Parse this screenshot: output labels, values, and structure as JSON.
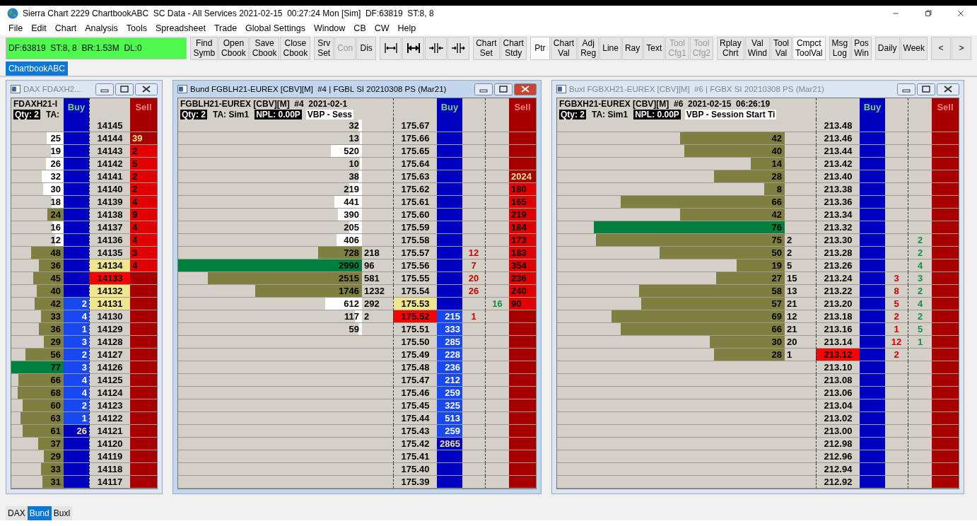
{
  "window": {
    "title": "Sierra Chart 2229 ChartbookABC  SC Data - All Services 2021-02-15  00:27:24 Mon [Sim]  DF:63819  ST:8, 8"
  },
  "menu": [
    "File",
    "Edit",
    "Chart",
    "Analysis",
    "Tools",
    "Spreadsheet",
    "Trade",
    "Global Settings",
    "Window",
    "CB",
    "CW",
    "Help"
  ],
  "status": "DF:63819  ST:8, 8  BR:1.53M  DL:0",
  "toolbar": {
    "groups": [
      [
        {
          "kind": "label",
          "lines": [
            "Find",
            "Symb"
          ],
          "selected": false,
          "disabled": false
        },
        {
          "kind": "label",
          "lines": [
            "Open",
            "Cbook"
          ],
          "selected": false,
          "disabled": false
        },
        {
          "kind": "label",
          "lines": [
            "Save",
            "Cbook"
          ],
          "selected": false,
          "disabled": false
        },
        {
          "kind": "label",
          "lines": [
            "Close",
            "Cbook"
          ],
          "selected": false,
          "disabled": false
        }
      ],
      [
        {
          "kind": "label",
          "lines": [
            "Srv",
            "Set"
          ],
          "selected": false,
          "disabled": false
        },
        {
          "kind": "label",
          "lines": [
            "Con"
          ],
          "selected": false,
          "disabled": true
        },
        {
          "kind": "label",
          "lines": [
            "Dis"
          ],
          "selected": false,
          "disabled": false
        }
      ],
      [
        {
          "kind": "icon",
          "selected": false,
          "disabled": false
        },
        {
          "kind": "icon",
          "selected": false,
          "disabled": false
        },
        {
          "kind": "icon",
          "selected": false,
          "disabled": false
        },
        {
          "kind": "icon",
          "selected": false,
          "disabled": false
        }
      ],
      [
        {
          "kind": "label",
          "lines": [
            "Chart",
            "Set"
          ],
          "selected": false,
          "disabled": false
        },
        {
          "kind": "label",
          "lines": [
            "Chart",
            "Stdy"
          ],
          "selected": false,
          "disabled": false
        }
      ],
      [
        {
          "kind": "label",
          "lines": [
            "Ptr"
          ],
          "selected": true,
          "disabled": false
        },
        {
          "kind": "label",
          "lines": [
            "Chart",
            "Val"
          ],
          "selected": false,
          "disabled": false
        },
        {
          "kind": "label",
          "lines": [
            "Adj",
            "Reg"
          ],
          "selected": false,
          "disabled": false
        },
        {
          "kind": "label",
          "lines": [
            "Line"
          ],
          "selected": false,
          "disabled": false
        },
        {
          "kind": "label",
          "lines": [
            "Ray"
          ],
          "selected": false,
          "disabled": false
        },
        {
          "kind": "label",
          "lines": [
            "Text"
          ],
          "selected": false,
          "disabled": false
        },
        {
          "kind": "label",
          "lines": [
            "Tool",
            "Cfg1"
          ],
          "selected": false,
          "disabled": true
        },
        {
          "kind": "label",
          "lines": [
            "Tool",
            "Cfg2"
          ],
          "selected": false,
          "disabled": true
        }
      ],
      [
        {
          "kind": "label",
          "lines": [
            "Rplay",
            "Chrt"
          ],
          "selected": false,
          "disabled": false
        },
        {
          "kind": "label",
          "lines": [
            "Val",
            "Wind"
          ],
          "selected": false,
          "disabled": false
        },
        {
          "kind": "label",
          "lines": [
            "Tool",
            "Val"
          ],
          "selected": false,
          "disabled": false
        },
        {
          "kind": "label",
          "lines": [
            "Cmpct",
            "ToolVal"
          ],
          "selected": true,
          "disabled": false
        }
      ],
      [
        {
          "kind": "label",
          "lines": [
            "Msg",
            "Log"
          ],
          "selected": false,
          "disabled": false
        },
        {
          "kind": "label",
          "lines": [
            "Pos",
            "Win"
          ],
          "selected": false,
          "disabled": false
        }
      ],
      [
        {
          "kind": "label",
          "lines": [
            "Daily"
          ],
          "selected": false,
          "disabled": false
        },
        {
          "kind": "label",
          "lines": [
            "Week"
          ],
          "selected": false,
          "disabled": false
        }
      ]
    ],
    "scroll": [
      "<",
      ">"
    ]
  },
  "chartbook_tabs": [
    {
      "label": "ChartbookABC",
      "selected": true
    }
  ],
  "windows": [
    {
      "title": "DAX FDAXH2...",
      "active": false,
      "kind": "compact",
      "symbol": "FDAXH21-I",
      "info": [
        {
          "text": "Qty: 2",
          "kind": "inverse"
        },
        {
          "text": "TA:",
          "kind": "plain"
        }
      ],
      "buy_header": "Buy",
      "sell_header": "Sell",
      "rows": [
        {
          "price": "14145",
          "kind": "none"
        },
        {
          "price": "14144",
          "volume": "25",
          "level": 0.32,
          "value_area": false,
          "poc": false,
          "kind": "none",
          "ask": {
            "text": "39",
            "total": true
          }
        },
        {
          "price": "14143",
          "volume": "19",
          "level": 0.25,
          "value_area": false,
          "poc": false,
          "kind": "none",
          "ask": {
            "text": "2",
            "total": false
          }
        },
        {
          "price": "14142",
          "volume": "26",
          "level": 0.34,
          "value_area": false,
          "poc": false,
          "kind": "none",
          "ask": {
            "text": "5",
            "total": false
          }
        },
        {
          "price": "14141",
          "volume": "32",
          "level": 0.42,
          "value_area": false,
          "poc": false,
          "kind": "none",
          "ask": {
            "text": "2",
            "total": false
          }
        },
        {
          "price": "14140",
          "volume": "30",
          "level": 0.39,
          "value_area": false,
          "poc": false,
          "kind": "none",
          "ask": {
            "text": "2",
            "total": false
          }
        },
        {
          "price": "14139",
          "volume": "18",
          "level": 0.23,
          "value_area": false,
          "poc": false,
          "kind": "none",
          "ask": {
            "text": "4",
            "total": false
          }
        },
        {
          "price": "14138",
          "volume": "24",
          "level": 0.31,
          "value_area": true,
          "poc": false,
          "kind": "none",
          "ask": {
            "text": "9",
            "total": false
          }
        },
        {
          "price": "14137",
          "volume": "16",
          "level": 0.21,
          "value_area": false,
          "poc": false,
          "kind": "none",
          "ask": {
            "text": "4",
            "total": false
          }
        },
        {
          "price": "14136",
          "volume": "12",
          "level": 0.16,
          "value_area": false,
          "poc": false,
          "kind": "none",
          "ask": {
            "text": "4",
            "total": false
          }
        },
        {
          "price": "14135",
          "volume": "48",
          "level": 0.62,
          "value_area": true,
          "poc": false,
          "kind": "none",
          "ask": {
            "text": "3",
            "total": false
          }
        },
        {
          "price": "14134",
          "volume": "36",
          "level": 0.47,
          "value_area": true,
          "poc": false,
          "kind": "range",
          "ask": {
            "text": "4",
            "total": false
          }
        },
        {
          "price": "14133",
          "volume": "45",
          "level": 0.58,
          "value_area": true,
          "poc": false,
          "kind": "trade"
        },
        {
          "price": "14132",
          "volume": "40",
          "level": 0.52,
          "value_area": true,
          "poc": false,
          "kind": "range"
        },
        {
          "price": "14131",
          "volume": "42",
          "level": 0.55,
          "value_area": true,
          "poc": false,
          "kind": "range",
          "bid": {
            "text": "2",
            "total": false
          }
        },
        {
          "price": "14130",
          "volume": "33",
          "level": 0.43,
          "value_area": true,
          "poc": false,
          "kind": "none",
          "bid": {
            "text": "4",
            "total": false
          }
        },
        {
          "price": "14129",
          "volume": "36",
          "level": 0.47,
          "value_area": true,
          "poc": false,
          "kind": "none",
          "bid": {
            "text": "1",
            "total": false
          }
        },
        {
          "price": "14128",
          "volume": "29",
          "level": 0.38,
          "value_area": true,
          "poc": false,
          "kind": "none",
          "bid": {
            "text": "3",
            "total": false
          }
        },
        {
          "price": "14127",
          "volume": "56",
          "level": 0.73,
          "value_area": true,
          "poc": false,
          "kind": "none",
          "bid": {
            "text": "2",
            "total": false
          }
        },
        {
          "price": "14126",
          "volume": "77",
          "level": 1,
          "value_area": true,
          "poc": true,
          "kind": "none",
          "bid": {
            "text": "3",
            "total": false
          }
        },
        {
          "price": "14125",
          "volume": "66",
          "level": 0.86,
          "value_area": true,
          "poc": false,
          "kind": "none",
          "bid": {
            "text": "4",
            "total": false
          }
        },
        {
          "price": "14124",
          "volume": "68",
          "level": 0.88,
          "value_area": true,
          "poc": false,
          "kind": "none",
          "bid": {
            "text": "4",
            "total": false
          }
        },
        {
          "price": "14123",
          "volume": "60",
          "level": 0.78,
          "value_area": true,
          "poc": false,
          "kind": "none",
          "bid": {
            "text": "2",
            "total": false
          }
        },
        {
          "price": "14122",
          "volume": "63",
          "level": 0.82,
          "value_area": true,
          "poc": false,
          "kind": "none",
          "bid": {
            "text": "1",
            "total": false
          }
        },
        {
          "price": "14121",
          "volume": "61",
          "level": 0.79,
          "value_area": true,
          "poc": false,
          "kind": "none",
          "bid": {
            "text": "26",
            "total": true
          }
        },
        {
          "price": "14120",
          "volume": "37",
          "level": 0.48,
          "value_area": true,
          "poc": false,
          "kind": "none"
        },
        {
          "price": "14119",
          "volume": "29",
          "level": 0.38,
          "value_area": true,
          "poc": false,
          "kind": "none"
        },
        {
          "price": "14118",
          "volume": "33",
          "level": 0.43,
          "value_area": true,
          "poc": false,
          "kind": "none"
        },
        {
          "price": "14117",
          "volume": "31",
          "level": 0.4,
          "value_area": true,
          "poc": false,
          "kind": "none"
        }
      ]
    },
    {
      "title": "Bund FGBLH21-EUREX [CBV][M]  #4 | FGBL SI 20210308 PS (Mar21)",
      "active": true,
      "kind": "full",
      "symbol": "FGBLH21-EUREX [CBV][M]  #4  2021-02-1",
      "info": [
        {
          "text": "Qty: 2",
          "kind": "inverse"
        },
        {
          "text": "TA: Sim1",
          "kind": "plain"
        },
        {
          "text": "NPL: 0.00P",
          "kind": "inverse"
        },
        {
          "text": "VBP - Sess",
          "kind": "boxed"
        }
      ],
      "buy_header": "Buy",
      "sell_header": "Sell",
      "rows": [
        {
          "price": "175.67",
          "volume": "32",
          "level": 0.02,
          "value_area": false,
          "poc": false,
          "kind": "none"
        },
        {
          "price": "175.66",
          "volume": "13",
          "level": 0.01,
          "value_area": false,
          "poc": false,
          "kind": "none"
        },
        {
          "price": "175.65",
          "volume": "520",
          "level": 0.17,
          "value_area": false,
          "poc": false,
          "kind": "none"
        },
        {
          "price": "175.64",
          "volume": "10",
          "level": 0.01,
          "value_area": false,
          "poc": false,
          "kind": "none"
        },
        {
          "price": "175.63",
          "volume": "38",
          "level": 0.02,
          "value_area": false,
          "poc": false,
          "kind": "none",
          "ask": {
            "text": "2024",
            "total": true
          }
        },
        {
          "price": "175.62",
          "volume": "219",
          "level": 0.07,
          "value_area": false,
          "poc": false,
          "kind": "none",
          "ask": {
            "text": "180",
            "total": false
          }
        },
        {
          "price": "175.61",
          "volume": "441",
          "level": 0.15,
          "value_area": false,
          "poc": false,
          "kind": "none",
          "ask": {
            "text": "165",
            "total": false
          }
        },
        {
          "price": "175.60",
          "volume": "390",
          "level": 0.13,
          "value_area": false,
          "poc": false,
          "kind": "none",
          "ask": {
            "text": "219",
            "total": false
          }
        },
        {
          "price": "175.59",
          "volume": "205",
          "level": 0.07,
          "value_area": false,
          "poc": false,
          "kind": "none",
          "ask": {
            "text": "184",
            "total": false
          }
        },
        {
          "price": "175.58",
          "volume": "406",
          "level": 0.14,
          "value_area": false,
          "poc": false,
          "kind": "none",
          "ask": {
            "text": "173",
            "total": false
          }
        },
        {
          "price": "175.57",
          "volume": "728",
          "level": 0.24,
          "value_area": true,
          "poc": false,
          "kind": "none",
          "column_2": "218",
          "column_5": "12",
          "ask": {
            "text": "183",
            "total": false
          }
        },
        {
          "price": "175.56",
          "volume": "2990",
          "level": 1,
          "value_area": true,
          "poc": true,
          "kind": "none",
          "column_2": "96",
          "column_5": "7",
          "ask": {
            "text": "354",
            "total": false
          }
        },
        {
          "price": "175.55",
          "volume": "2515",
          "level": 0.84,
          "value_area": true,
          "poc": false,
          "kind": "none",
          "column_2": "581",
          "column_5": "20",
          "ask": {
            "text": "236",
            "total": false
          }
        },
        {
          "price": "175.54",
          "volume": "1746",
          "level": 0.58,
          "value_area": true,
          "poc": false,
          "kind": "none",
          "column_2": "1232",
          "column_5": "26",
          "ask": {
            "text": "240",
            "total": false
          }
        },
        {
          "price": "175.53",
          "volume": "612",
          "level": 0.2,
          "value_area": false,
          "poc": false,
          "kind": "range",
          "column_2": "292",
          "column_6": "16",
          "ask": {
            "text": "90",
            "total": false
          }
        },
        {
          "price": "175.52",
          "volume": "117",
          "level": 0.04,
          "value_area": false,
          "poc": false,
          "kind": "trade",
          "column_2": "2",
          "bid": {
            "text": "215",
            "total": false
          },
          "column_5": "1"
        },
        {
          "price": "175.51",
          "volume": "59",
          "level": 0.02,
          "value_area": false,
          "poc": false,
          "kind": "none",
          "bid": {
            "text": "333",
            "total": false
          }
        },
        {
          "price": "175.50",
          "kind": "none",
          "bid": {
            "text": "285",
            "total": false
          }
        },
        {
          "price": "175.49",
          "kind": "none",
          "bid": {
            "text": "228",
            "total": false
          }
        },
        {
          "price": "175.48",
          "kind": "none",
          "bid": {
            "text": "236",
            "total": false
          }
        },
        {
          "price": "175.47",
          "kind": "none",
          "bid": {
            "text": "212",
            "total": false
          }
        },
        {
          "price": "175.46",
          "kind": "none",
          "bid": {
            "text": "259",
            "total": false
          }
        },
        {
          "price": "175.45",
          "kind": "none",
          "bid": {
            "text": "325",
            "total": false
          }
        },
        {
          "price": "175.44",
          "kind": "none",
          "bid": {
            "text": "513",
            "total": false
          }
        },
        {
          "price": "175.43",
          "kind": "none",
          "bid": {
            "text": "259",
            "total": false
          }
        },
        {
          "price": "175.42",
          "kind": "none",
          "bid": {
            "text": "2865",
            "total": true
          }
        },
        {
          "price": "175.41",
          "kind": "none"
        },
        {
          "price": "175.40",
          "kind": "none"
        },
        {
          "price": "175.39",
          "kind": "none"
        }
      ]
    },
    {
      "title": "Buxl FGBXH21-EUREX [CBV][M]  #6 | FGBX SI 20210308 PS (Mar21)",
      "active": false,
      "kind": "full",
      "symbol": "FGBXH21-EUREX [CBV][M]  #6  2021-02-15  06:26:19",
      "info": [
        {
          "text": "Qty: 2",
          "kind": "inverse"
        },
        {
          "text": "TA: Sim1",
          "kind": "plain"
        },
        {
          "text": "NPL: 0.00P",
          "kind": "inverse"
        },
        {
          "text": "VBP - Session Start Ti",
          "kind": "boxed"
        }
      ],
      "buy_header": "Buy",
      "sell_header": "Sell",
      "rows": [
        {
          "price": "213.48",
          "kind": "none"
        },
        {
          "price": "213.46",
          "volume": "42",
          "level": 0.46,
          "value_area": true,
          "poc": false,
          "kind": "none"
        },
        {
          "price": "213.44",
          "volume": "40",
          "level": 0.44,
          "value_area": true,
          "poc": false,
          "kind": "none"
        },
        {
          "price": "213.42",
          "volume": "14",
          "level": 0.15,
          "value_area": true,
          "poc": false,
          "kind": "none"
        },
        {
          "price": "213.40",
          "volume": "28",
          "level": 0.31,
          "value_area": true,
          "poc": false,
          "kind": "none"
        },
        {
          "price": "213.38",
          "volume": "8",
          "level": 0.09,
          "value_area": true,
          "poc": false,
          "kind": "none"
        },
        {
          "price": "213.36",
          "volume": "66",
          "level": 0.72,
          "value_area": true,
          "poc": false,
          "kind": "none"
        },
        {
          "price": "213.34",
          "volume": "42",
          "level": 0.46,
          "value_area": true,
          "poc": false,
          "kind": "none"
        },
        {
          "price": "213.32",
          "volume": "76",
          "level": 0.84,
          "value_area": true,
          "poc": true,
          "kind": "none"
        },
        {
          "price": "213.30",
          "volume": "75",
          "level": 0.83,
          "value_area": true,
          "poc": false,
          "kind": "none",
          "column_2": "2",
          "column_6": "2"
        },
        {
          "price": "213.28",
          "volume": "50",
          "level": 0.55,
          "value_area": true,
          "poc": false,
          "kind": "none",
          "column_2": "2",
          "column_6": "2"
        },
        {
          "price": "213.26",
          "volume": "19",
          "level": 0.21,
          "value_area": true,
          "poc": false,
          "kind": "none",
          "column_2": "5",
          "column_6": "4"
        },
        {
          "price": "213.24",
          "volume": "27",
          "level": 0.3,
          "value_area": true,
          "poc": false,
          "kind": "none",
          "column_2": "15",
          "column_5": "3",
          "column_6": "3"
        },
        {
          "price": "213.22",
          "volume": "58",
          "level": 0.64,
          "value_area": true,
          "poc": false,
          "kind": "none",
          "column_2": "13",
          "column_5": "8",
          "column_6": "2"
        },
        {
          "price": "213.20",
          "volume": "57",
          "level": 0.63,
          "value_area": true,
          "poc": false,
          "kind": "none",
          "column_2": "21",
          "column_5": "5",
          "column_6": "4"
        },
        {
          "price": "213.18",
          "volume": "69",
          "level": 0.76,
          "value_area": true,
          "poc": false,
          "kind": "none",
          "column_2": "12",
          "column_5": "2",
          "column_6": "2"
        },
        {
          "price": "213.16",
          "volume": "66",
          "level": 0.72,
          "value_area": true,
          "poc": false,
          "kind": "none",
          "column_2": "21",
          "column_5": "1",
          "column_6": "5"
        },
        {
          "price": "213.14",
          "volume": "30",
          "level": 0.33,
          "value_area": true,
          "poc": false,
          "kind": "none",
          "column_2": "20",
          "column_5": "12",
          "column_6": "1"
        },
        {
          "price": "213.12",
          "volume": "28",
          "level": 0.31,
          "value_area": true,
          "poc": false,
          "kind": "trade",
          "column_2": "1",
          "column_5": "2"
        },
        {
          "price": "213.10",
          "kind": "none"
        },
        {
          "price": "213.08",
          "kind": "none"
        },
        {
          "price": "213.06",
          "kind": "none"
        },
        {
          "price": "213.04",
          "kind": "none"
        },
        {
          "price": "213.02",
          "kind": "none"
        },
        {
          "price": "213.00",
          "kind": "none"
        },
        {
          "price": "212.98",
          "kind": "none"
        },
        {
          "price": "212.96",
          "kind": "none"
        },
        {
          "price": "212.94",
          "kind": "none"
        },
        {
          "price": "212.92",
          "kind": "none"
        }
      ]
    }
  ],
  "bottom_tabs": [
    {
      "label": "DAX",
      "selected": false
    },
    {
      "label": "Bund",
      "selected": true
    },
    {
      "label": "Buxl",
      "selected": false
    }
  ]
}
